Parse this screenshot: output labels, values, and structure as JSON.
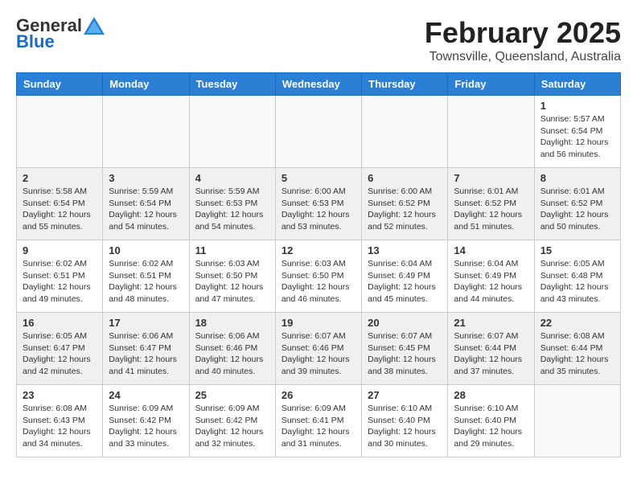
{
  "header": {
    "logo_general": "General",
    "logo_blue": "Blue",
    "month_title": "February 2025",
    "location": "Townsville, Queensland, Australia"
  },
  "weekdays": [
    "Sunday",
    "Monday",
    "Tuesday",
    "Wednesday",
    "Thursday",
    "Friday",
    "Saturday"
  ],
  "weeks": [
    [
      {
        "day": "",
        "info": ""
      },
      {
        "day": "",
        "info": ""
      },
      {
        "day": "",
        "info": ""
      },
      {
        "day": "",
        "info": ""
      },
      {
        "day": "",
        "info": ""
      },
      {
        "day": "",
        "info": ""
      },
      {
        "day": "1",
        "info": "Sunrise: 5:57 AM\nSunset: 6:54 PM\nDaylight: 12 hours\nand 56 minutes."
      }
    ],
    [
      {
        "day": "2",
        "info": "Sunrise: 5:58 AM\nSunset: 6:54 PM\nDaylight: 12 hours\nand 55 minutes."
      },
      {
        "day": "3",
        "info": "Sunrise: 5:59 AM\nSunset: 6:54 PM\nDaylight: 12 hours\nand 54 minutes."
      },
      {
        "day": "4",
        "info": "Sunrise: 5:59 AM\nSunset: 6:53 PM\nDaylight: 12 hours\nand 54 minutes."
      },
      {
        "day": "5",
        "info": "Sunrise: 6:00 AM\nSunset: 6:53 PM\nDaylight: 12 hours\nand 53 minutes."
      },
      {
        "day": "6",
        "info": "Sunrise: 6:00 AM\nSunset: 6:52 PM\nDaylight: 12 hours\nand 52 minutes."
      },
      {
        "day": "7",
        "info": "Sunrise: 6:01 AM\nSunset: 6:52 PM\nDaylight: 12 hours\nand 51 minutes."
      },
      {
        "day": "8",
        "info": "Sunrise: 6:01 AM\nSunset: 6:52 PM\nDaylight: 12 hours\nand 50 minutes."
      }
    ],
    [
      {
        "day": "9",
        "info": "Sunrise: 6:02 AM\nSunset: 6:51 PM\nDaylight: 12 hours\nand 49 minutes."
      },
      {
        "day": "10",
        "info": "Sunrise: 6:02 AM\nSunset: 6:51 PM\nDaylight: 12 hours\nand 48 minutes."
      },
      {
        "day": "11",
        "info": "Sunrise: 6:03 AM\nSunset: 6:50 PM\nDaylight: 12 hours\nand 47 minutes."
      },
      {
        "day": "12",
        "info": "Sunrise: 6:03 AM\nSunset: 6:50 PM\nDaylight: 12 hours\nand 46 minutes."
      },
      {
        "day": "13",
        "info": "Sunrise: 6:04 AM\nSunset: 6:49 PM\nDaylight: 12 hours\nand 45 minutes."
      },
      {
        "day": "14",
        "info": "Sunrise: 6:04 AM\nSunset: 6:49 PM\nDaylight: 12 hours\nand 44 minutes."
      },
      {
        "day": "15",
        "info": "Sunrise: 6:05 AM\nSunset: 6:48 PM\nDaylight: 12 hours\nand 43 minutes."
      }
    ],
    [
      {
        "day": "16",
        "info": "Sunrise: 6:05 AM\nSunset: 6:47 PM\nDaylight: 12 hours\nand 42 minutes."
      },
      {
        "day": "17",
        "info": "Sunrise: 6:06 AM\nSunset: 6:47 PM\nDaylight: 12 hours\nand 41 minutes."
      },
      {
        "day": "18",
        "info": "Sunrise: 6:06 AM\nSunset: 6:46 PM\nDaylight: 12 hours\nand 40 minutes."
      },
      {
        "day": "19",
        "info": "Sunrise: 6:07 AM\nSunset: 6:46 PM\nDaylight: 12 hours\nand 39 minutes."
      },
      {
        "day": "20",
        "info": "Sunrise: 6:07 AM\nSunset: 6:45 PM\nDaylight: 12 hours\nand 38 minutes."
      },
      {
        "day": "21",
        "info": "Sunrise: 6:07 AM\nSunset: 6:44 PM\nDaylight: 12 hours\nand 37 minutes."
      },
      {
        "day": "22",
        "info": "Sunrise: 6:08 AM\nSunset: 6:44 PM\nDaylight: 12 hours\nand 35 minutes."
      }
    ],
    [
      {
        "day": "23",
        "info": "Sunrise: 6:08 AM\nSunset: 6:43 PM\nDaylight: 12 hours\nand 34 minutes."
      },
      {
        "day": "24",
        "info": "Sunrise: 6:09 AM\nSunset: 6:42 PM\nDaylight: 12 hours\nand 33 minutes."
      },
      {
        "day": "25",
        "info": "Sunrise: 6:09 AM\nSunset: 6:42 PM\nDaylight: 12 hours\nand 32 minutes."
      },
      {
        "day": "26",
        "info": "Sunrise: 6:09 AM\nSunset: 6:41 PM\nDaylight: 12 hours\nand 31 minutes."
      },
      {
        "day": "27",
        "info": "Sunrise: 6:10 AM\nSunset: 6:40 PM\nDaylight: 12 hours\nand 30 minutes."
      },
      {
        "day": "28",
        "info": "Sunrise: 6:10 AM\nSunset: 6:40 PM\nDaylight: 12 hours\nand 29 minutes."
      },
      {
        "day": "",
        "info": ""
      }
    ]
  ]
}
